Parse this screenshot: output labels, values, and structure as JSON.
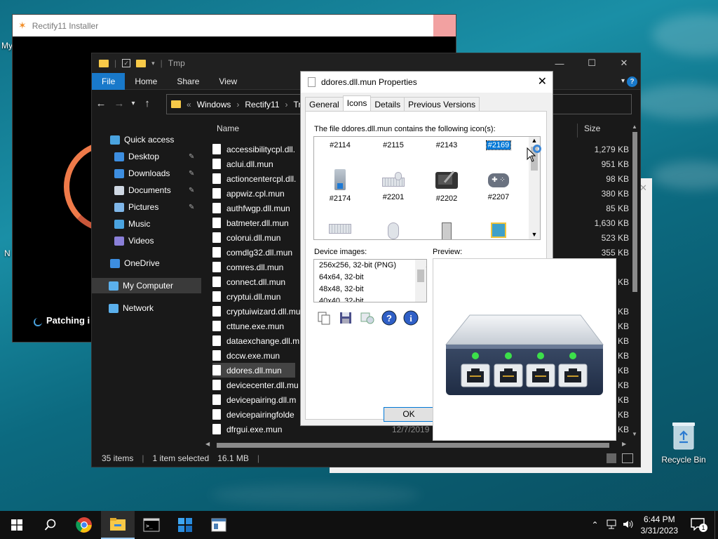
{
  "desktop": {
    "recycle_bin_label": "Recycle Bin",
    "edge_label_1": "My",
    "edge_label_2": "N"
  },
  "installer": {
    "title": "Rectify11 Installer",
    "status_text": "Patching i"
  },
  "explorer": {
    "title": "Tmp",
    "ribbon": [
      "File",
      "Home",
      "Share",
      "View"
    ],
    "address": [
      "Windows",
      "Rectify11",
      "Tr"
    ],
    "nav": [
      {
        "label": "Quick access",
        "icon": "star-icon",
        "color": "#4aa3df"
      },
      {
        "label": "Desktop",
        "icon": "desktop-icon",
        "color": "#3d8ee0",
        "pinned": true
      },
      {
        "label": "Downloads",
        "icon": "download-icon",
        "color": "#3d8ee0",
        "pinned": true
      },
      {
        "label": "Documents",
        "icon": "document-icon",
        "color": "#cfd8e3",
        "pinned": true
      },
      {
        "label": "Pictures",
        "icon": "picture-icon",
        "color": "#7fb6e8",
        "pinned": true
      },
      {
        "label": "Music",
        "icon": "music-icon",
        "color": "#4aa3df"
      },
      {
        "label": "Videos",
        "icon": "video-icon",
        "color": "#8a7fd8"
      },
      {
        "label": "OneDrive",
        "icon": "cloud-icon",
        "color": "#3d8ee0"
      },
      {
        "label": "My Computer",
        "icon": "computer-icon",
        "color": "#5bb0ec",
        "selected": true
      },
      {
        "label": "Network",
        "icon": "network-icon",
        "color": "#5bb0ec"
      }
    ],
    "columns": {
      "name": "Name",
      "size": "Size"
    },
    "files": [
      {
        "name": "accessibilitycpl.dll.",
        "size": "1,279 KB"
      },
      {
        "name": "aclui.dll.mun",
        "size": "951 KB"
      },
      {
        "name": "actioncentercpl.dll.",
        "size": "98 KB"
      },
      {
        "name": "appwiz.cpl.mun",
        "size": "380 KB"
      },
      {
        "name": "authfwgp.dll.mun",
        "size": "85 KB"
      },
      {
        "name": "batmeter.dll.mun",
        "size": "1,630 KB"
      },
      {
        "name": "colorui.dll.mun",
        "size": "523 KB"
      },
      {
        "name": "comdlg32.dll.mun",
        "size": "355 KB"
      },
      {
        "name": "comres.dll.mun",
        "size": ""
      },
      {
        "name": "connect.dll.mun",
        "size": "7 KB"
      },
      {
        "name": "cryptui.dll.mun",
        "size": ""
      },
      {
        "name": "cryptuiwizard.dll.mu",
        "size": "5 KB"
      },
      {
        "name": "cttune.exe.mun",
        "size": "7 KB"
      },
      {
        "name": "dataexchange.dll.m",
        "size": "3 KB"
      },
      {
        "name": "dccw.exe.mun",
        "size": "3 KB"
      },
      {
        "name": "ddores.dll.mun",
        "size": "0 KB",
        "selected": true
      },
      {
        "name": "devicecenter.dll.mu",
        "size": "4 KB"
      },
      {
        "name": "devicepairing.dll.m",
        "size": "4 KB"
      },
      {
        "name": "devicepairingfolde",
        "size": "2 KB"
      },
      {
        "name": "dfrgui.exe.mun",
        "size": "0 KB",
        "date": "12/7/2019"
      }
    ],
    "status": {
      "items": "35 items",
      "selected": "1 item selected",
      "size": "16.1 MB"
    }
  },
  "props": {
    "title": "ddores.dll.mun Properties",
    "tabs": [
      "General",
      "Icons",
      "Details",
      "Previous Versions"
    ],
    "active_tab": "Icons",
    "contains_text": "The file ddores.dll.mun contains the following icon(s):",
    "icons": [
      {
        "id": "#2114"
      },
      {
        "id": "#2115"
      },
      {
        "id": "#2143"
      },
      {
        "id": "#2169",
        "selected": true
      },
      {
        "id": "#2174"
      },
      {
        "id": "#2201"
      },
      {
        "id": "#2202"
      },
      {
        "id": "#2207"
      }
    ],
    "device_images_label": "Device images:",
    "preview_label": "Preview:",
    "device_images": [
      "256x256, 32-bit (PNG)",
      "64x64, 32-bit",
      "48x48, 32-bit",
      "40x40, 32-bit"
    ],
    "ok_label": "OK"
  },
  "taskbar": {
    "time": "6:44 PM",
    "date": "3/31/2023",
    "notif_count": "1"
  }
}
